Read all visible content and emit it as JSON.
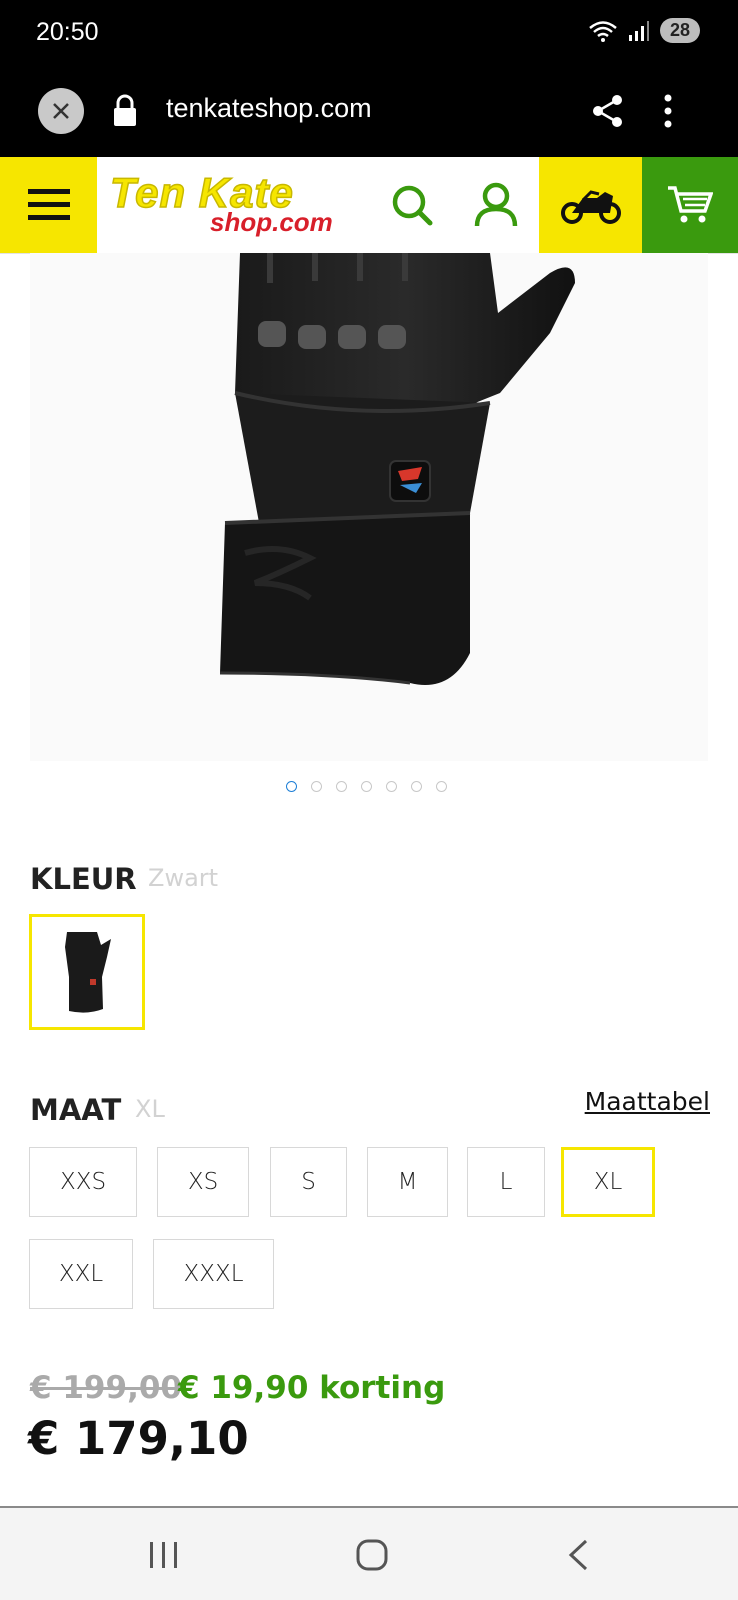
{
  "status": {
    "time": "20:50",
    "battery": "28"
  },
  "browser": {
    "url": "tenkateshop.com"
  },
  "header": {
    "logo_top": "Ten Kate",
    "logo_bottom": "shop.com",
    "colors": {
      "yellow": "#f6e600",
      "green": "#3a9a0e",
      "red": "#d81f2a"
    }
  },
  "gallery": {
    "dot_count": 7,
    "active_index": 0
  },
  "color": {
    "label": "KLEUR",
    "value": "Zwart"
  },
  "size": {
    "label": "MAAT",
    "value": "XL",
    "chart_link": "Maattabel",
    "options": [
      "XXS",
      "XS",
      "S",
      "M",
      "L",
      "XL",
      "XXL",
      "XXXL"
    ],
    "selected": "XL"
  },
  "pricing": {
    "old_price": "€ 199,00",
    "discount": "€ 19,90 korting",
    "price": "€ 179,10"
  }
}
